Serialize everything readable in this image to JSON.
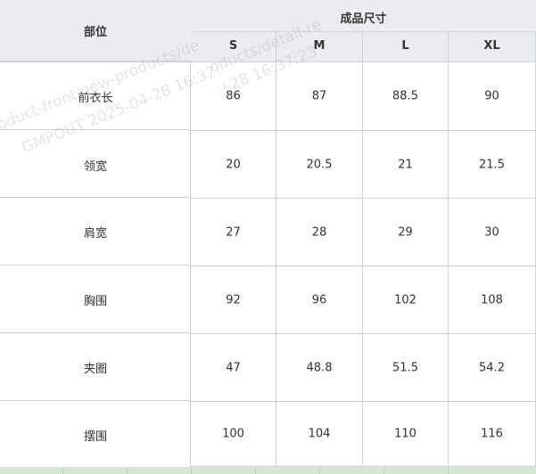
{
  "table": {
    "part_header": "部位",
    "size_group_header": "成品尺寸",
    "sizes": [
      "S",
      "M",
      "L",
      "XL"
    ],
    "rows": [
      {
        "label": "前衣长",
        "values": [
          "86",
          "87",
          "88.5",
          "90"
        ]
      },
      {
        "label": "领宽",
        "values": [
          "20",
          "20.5",
          "21",
          "21.5"
        ]
      },
      {
        "label": "肩宽",
        "values": [
          "27",
          "28",
          "29",
          "30"
        ]
      },
      {
        "label": "胸围",
        "values": [
          "92",
          "96",
          "102",
          "108"
        ]
      },
      {
        "label": "夹圈",
        "values": [
          "47",
          "48.8",
          "51.5",
          "54.2"
        ]
      },
      {
        "label": "摆围",
        "values": [
          "100",
          "104",
          "110",
          "116"
        ]
      }
    ]
  },
  "watermark": {
    "line1a": "oduct-front/new-products/de",
    "line1b": "oducts/detail-re",
    "line2a": "GMPOUT 2025-04-28 16:37:",
    "line2b": "+28 16:37:23"
  },
  "colors": {
    "header_bg": "#eaecf0",
    "border": "#cfd3d8",
    "bottom_strip": "#d6e8d4"
  }
}
